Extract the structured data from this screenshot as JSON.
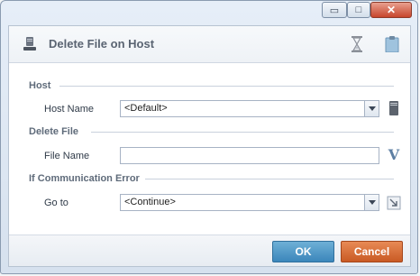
{
  "window": {
    "controls": {
      "minimize": "▭",
      "maximize": "□",
      "close": "✕"
    }
  },
  "header": {
    "title": "Delete File on Host",
    "icons": [
      "server-icon",
      "hourglass-icon",
      "clipboard-icon"
    ]
  },
  "sections": {
    "host": {
      "label": "Host",
      "field_label": "Host Name",
      "value": "<Default>"
    },
    "delete_file": {
      "label": "Delete File",
      "field_label": "File Name",
      "value": "",
      "variable_button": "V"
    },
    "comm_error": {
      "label": "If Communication Error",
      "field_label": "Go to",
      "value": "<Continue>"
    }
  },
  "footer": {
    "ok_label": "OK",
    "cancel_label": "Cancel"
  },
  "colors": {
    "ok": "#3b86bb",
    "cancel": "#c95a24"
  }
}
